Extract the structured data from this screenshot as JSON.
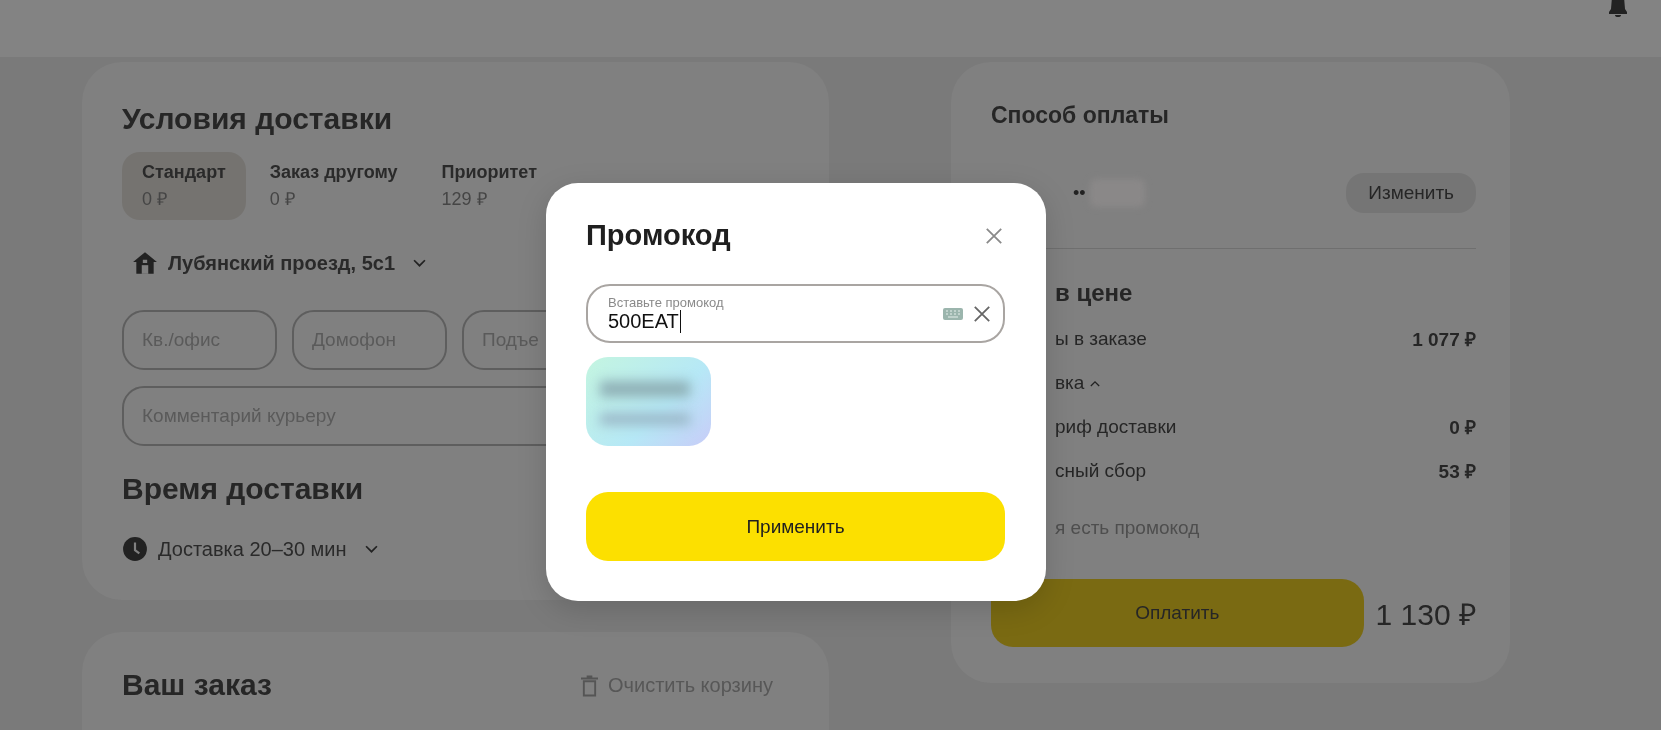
{
  "delivery": {
    "title": "Условия доставки",
    "tabs": [
      {
        "label": "Стандарт",
        "price": "0 ₽",
        "selected": true
      },
      {
        "label": "Заказ другому",
        "price": "0 ₽",
        "selected": false
      },
      {
        "label": "Приоритет",
        "price": "129 ₽",
        "selected": false
      }
    ],
    "address": "Лубянский проезд, 5с1",
    "fields": [
      {
        "placeholder": "Кв./офис"
      },
      {
        "placeholder": "Домофон"
      },
      {
        "placeholder": "Подъе"
      }
    ],
    "comment": {
      "placeholder": "Комментарий курьеру"
    }
  },
  "time": {
    "title": "Время доставки",
    "option": "Доставка 20–30 мин"
  },
  "order": {
    "title": "Ваш заказ",
    "clear_button": "Очистить корзину"
  },
  "payment": {
    "title": "Способ оплаты",
    "card_mask": "••",
    "change_button": "Изменить",
    "summary_title": "в цене",
    "rows": [
      {
        "kind": "item",
        "label": "ы в заказе",
        "value": "1 077 ₽"
      },
      {
        "kind": "toggle",
        "label": "вка",
        "expanded": true
      },
      {
        "kind": "item",
        "label": "риф доставки",
        "value": "0 ₽"
      },
      {
        "kind": "item",
        "label": "сный сбор",
        "value": "53 ₽"
      }
    ],
    "promo_link": "я есть промокод",
    "pay_button": "Оплатить",
    "total": "1 130 ₽"
  },
  "modal": {
    "title": "Промокод",
    "field": {
      "label": "Вставьте промокод",
      "value": "500EAT"
    },
    "apply_button": "Применить"
  }
}
